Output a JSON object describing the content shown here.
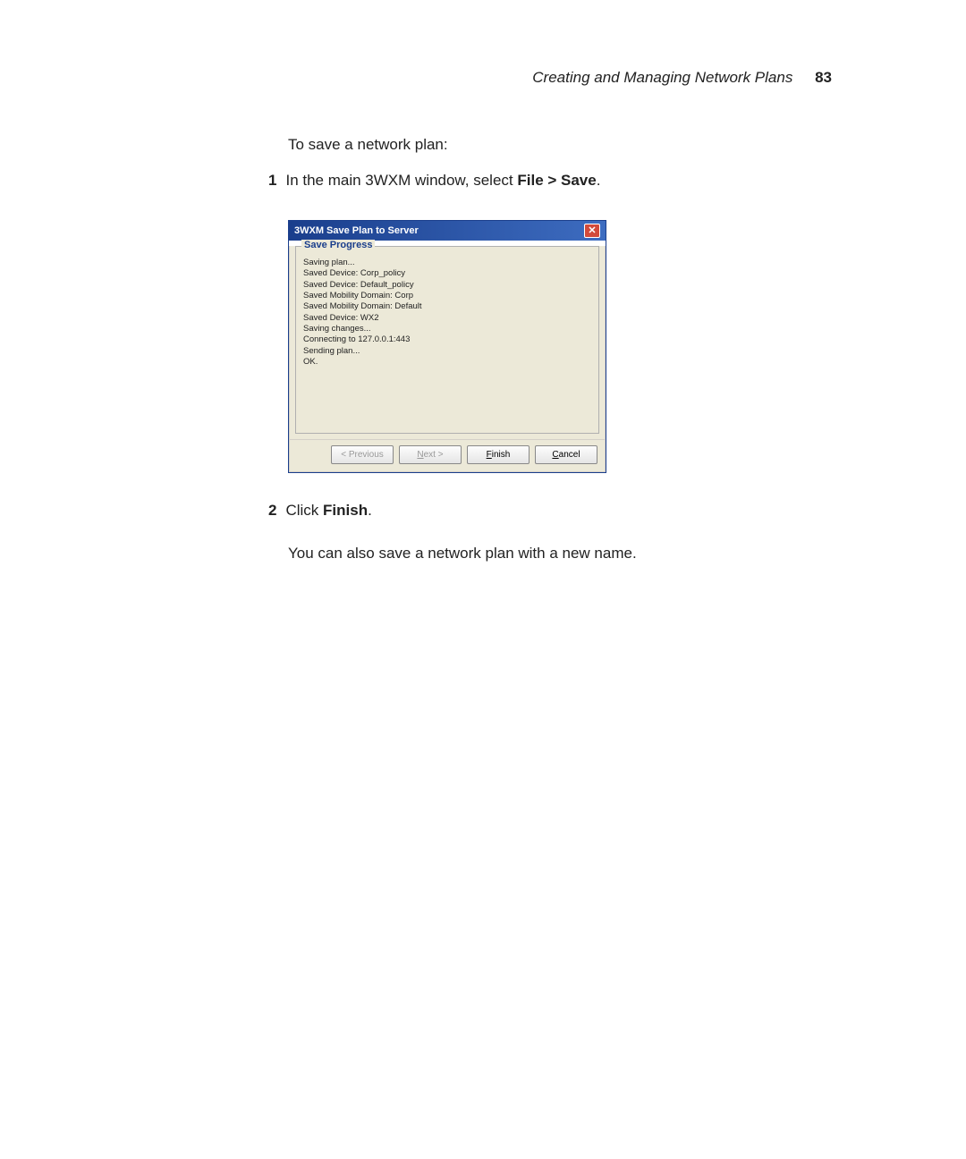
{
  "header": {
    "title": "Creating and Managing Network Plans",
    "page_number": "83"
  },
  "intro": "To save a network plan:",
  "step1": {
    "number": "1",
    "prefix": "In the main 3WXM window, select ",
    "bold1": "File > Save",
    "suffix": "."
  },
  "dialog": {
    "title": "3WXM Save Plan to Server",
    "group_label": "Save Progress",
    "log": [
      "Saving plan...",
      "Saved Device: Corp_policy",
      "Saved Device: Default_policy",
      "Saved Mobility Domain: Corp",
      "Saved Mobility Domain: Default",
      "Saved Device: WX2",
      "Saving changes...",
      "Connecting to 127.0.0.1:443",
      "Sending plan...",
      "OK."
    ],
    "buttons": {
      "previous": "< Previous",
      "next": "Next >",
      "finish": "Finish",
      "cancel": "Cancel"
    }
  },
  "step2": {
    "number": "2",
    "prefix": "Click ",
    "bold1": "Finish",
    "suffix": "."
  },
  "followup": "You can also save a network plan with a new name."
}
